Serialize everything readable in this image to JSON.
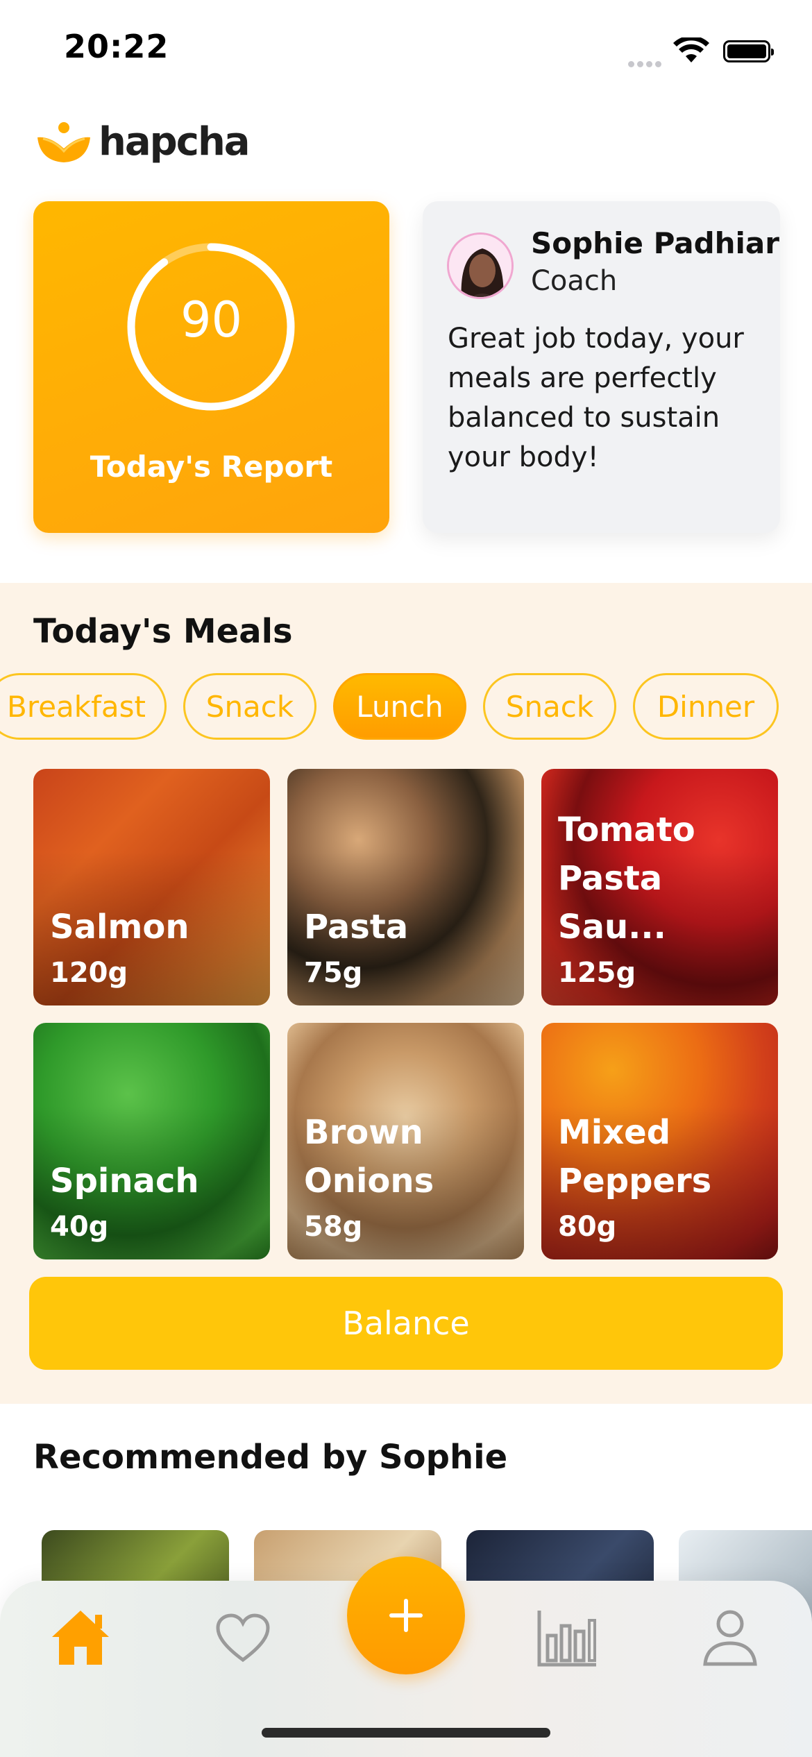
{
  "status_bar": {
    "time": "20:22"
  },
  "brand": {
    "name": "hapcha",
    "accent": "#FFA800"
  },
  "report": {
    "score": "90",
    "label": "Today's Report",
    "progress": 0.9
  },
  "coach": {
    "name": "Sophie Padhiar",
    "role": "Coach",
    "message": "Great job today, your meals are perfectly balanced to sustain your body!"
  },
  "meals": {
    "title": "Today's Meals",
    "tabs": [
      {
        "label": "Breakfast",
        "active": false
      },
      {
        "label": "Snack",
        "active": false
      },
      {
        "label": "Lunch",
        "active": true
      },
      {
        "label": "Snack",
        "active": false
      },
      {
        "label": "Dinner",
        "active": false
      }
    ],
    "items": [
      {
        "name": "Salmon",
        "weight": "120g"
      },
      {
        "name": "Pasta",
        "weight": "75g"
      },
      {
        "name": "Tomato Pasta Sau...",
        "weight": "125g"
      },
      {
        "name": "Spinach",
        "weight": "40g"
      },
      {
        "name": "Brown Onions",
        "weight": "58g"
      },
      {
        "name": "Mixed Peppers",
        "weight": "80g"
      }
    ],
    "balance_label": "Balance"
  },
  "recommended": {
    "title": "Recommended by Sophie"
  },
  "tabbar": {
    "items": [
      {
        "icon": "home-icon",
        "active": true
      },
      {
        "icon": "heart-icon",
        "active": false
      },
      {
        "icon": "plus-icon",
        "active": false
      },
      {
        "icon": "chart-icon",
        "active": false
      },
      {
        "icon": "profile-icon",
        "active": false
      }
    ]
  }
}
